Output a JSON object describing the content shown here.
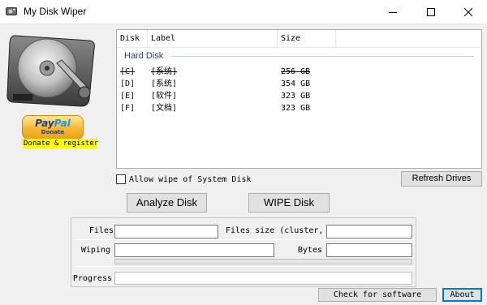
{
  "window": {
    "title": "My Disk Wiper",
    "controls": {
      "minimize": "minimize-icon",
      "maximize": "maximize-icon",
      "close": "close-icon"
    }
  },
  "donate": {
    "paypal_brand_left": "Pay",
    "paypal_brand_right": "Pal",
    "paypal_sub": "Donate",
    "label": "Donate & register"
  },
  "drive_list": {
    "columns": [
      "Disk",
      "Label",
      "Size"
    ],
    "group": "Hard Disk",
    "rows": [
      {
        "disk": "[C]",
        "label": "[系统]",
        "size": "256 GB"
      },
      {
        "disk": "[D]",
        "label": "[系统]",
        "size": "354 GB"
      },
      {
        "disk": "[E]",
        "label": "[软件]",
        "size": "323 GB"
      },
      {
        "disk": "[F]",
        "label": "[文档]",
        "size": "323 GB"
      }
    ]
  },
  "options": {
    "allow_system_wipe": {
      "label": "Allow wipe of System Disk",
      "checked": false
    }
  },
  "buttons": {
    "refresh": "Refresh Drives",
    "analyze": "Analyze Disk",
    "wipe": "WIPE Disk",
    "check_software": "Check for software",
    "about": "About"
  },
  "status": {
    "files_label": "Files",
    "files_value": "",
    "files_size_label": "Files size (cluster,",
    "files_size_value": "",
    "wiping_label": "Wiping",
    "wiping_value": "",
    "bytes_label": "Bytes",
    "bytes_value": "",
    "progress_label": "Progress",
    "progress_value": ""
  },
  "colors": {
    "group_label": "#1e3f99",
    "donate_highlight": "#ffff00",
    "default_button_border": "#0078d7"
  }
}
